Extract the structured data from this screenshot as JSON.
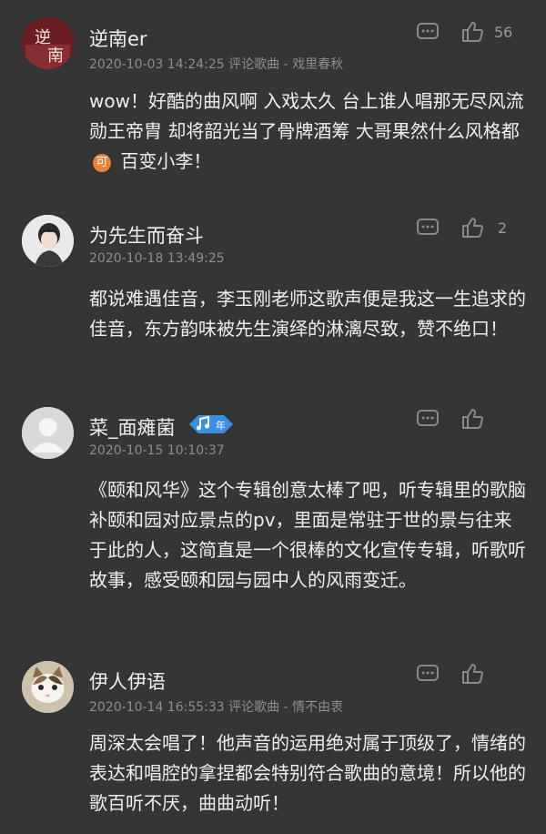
{
  "comments": [
    {
      "username": "逆南er",
      "meta": "2020-10-03 14:24:25 评论歌曲 - 戏里春秋",
      "text_before": "wow！好酷的曲风啊 入戏太久 台上谁人唱那无尽风流 勋王帝胄 却将韶光当了骨牌酒筹 大哥果然什么风格都",
      "badge": "可",
      "text_after": " 百变小李！",
      "likes": "56",
      "avatar_text": "逆 南"
    },
    {
      "username": "为先生而奋斗",
      "meta": "2020-10-18 13:49:25",
      "text": "都说难遇佳音，李玉刚老师这歌声便是我这一生追求的佳音，东方韵味被先生演绎的淋漓尽致，赞不绝口！",
      "likes": "2"
    },
    {
      "username": "菜_面瘫菌",
      "meta": "2020-10-15 10:10:37",
      "text": "《颐和风华》这个专辑创意太棒了吧，听专辑里的歌脑补颐和园对应景点的pv，里面是常驻于世的景与往来于此的人，这简直是一个很棒的文化宣传专辑，听歌听故事，感受颐和园与园中人的风雨变迁。",
      "badge_text": "年",
      "likes": ""
    },
    {
      "username": "伊人伊语",
      "meta": "2020-10-14 16:55:33 评论歌曲 - 情不由衷",
      "text": "周深太会唱了！他声音的运用绝对属于顶级了，情绪的表达和唱腔的拿捏都会特别符合歌曲的意境！所以他的歌百听不厌，曲曲动听！",
      "likes": ""
    }
  ],
  "colors": {
    "background": "#353535",
    "username": "#f0f0f0",
    "meta": "#8e8e8e",
    "icon": "#8a8a8a",
    "badge": "#e8823a",
    "vip": "#3a8fe0"
  },
  "icons": [
    "comment-icon",
    "thumbs-up-icon",
    "music-note-icon"
  ]
}
